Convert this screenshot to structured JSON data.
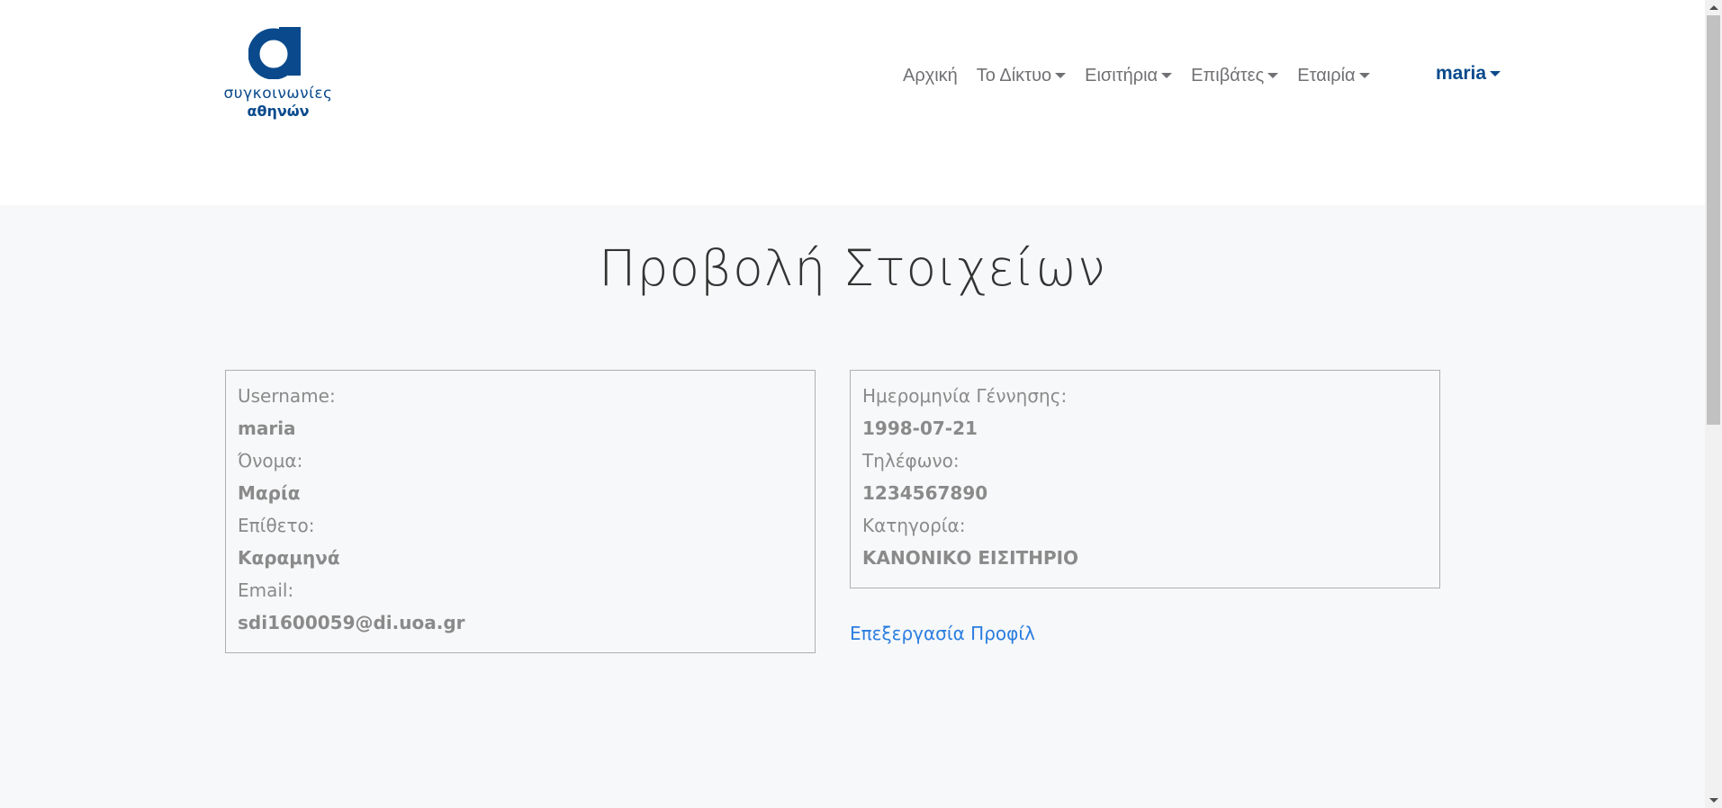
{
  "logo": {
    "line1": "συγκοινωνίες",
    "line2": "αθηνών",
    "color": "#0a4a8c"
  },
  "nav": {
    "items": [
      {
        "label": "Αρχική",
        "has_dropdown": false
      },
      {
        "label": "Το Δίκτυο",
        "has_dropdown": true
      },
      {
        "label": "Εισιτήρια",
        "has_dropdown": true
      },
      {
        "label": "Επιβάτες",
        "has_dropdown": true
      },
      {
        "label": "Εταιρία",
        "has_dropdown": true
      }
    ],
    "user": "maria"
  },
  "page": {
    "title": "Προβολή Στοιχείων"
  },
  "profile_left": [
    {
      "label": "Username:",
      "value": "maria"
    },
    {
      "label": "Όνομα:",
      "value": "Μαρία"
    },
    {
      "label": "Επίθετο:",
      "value": "Καραμηνά"
    },
    {
      "label": "Email:",
      "value": "sdi1600059@di.uoa.gr"
    }
  ],
  "profile_right": [
    {
      "label": "Ημερομηνία Γέννησης:",
      "value": "1998-07-21"
    },
    {
      "label": "Τηλέφωνο:",
      "value": "1234567890"
    },
    {
      "label": "Κατηγορία:",
      "value": "ΚΑΝΟΝΙΚΟ ΕΙΣΙΤΗΡΙΟ"
    }
  ],
  "actions": {
    "edit_profile": "Επεξεργασία Προφίλ"
  },
  "colors": {
    "brand": "#0a4a8c",
    "link": "#2b7de0",
    "text_muted": "#8a8a8a",
    "background": "#f7f8f9"
  }
}
